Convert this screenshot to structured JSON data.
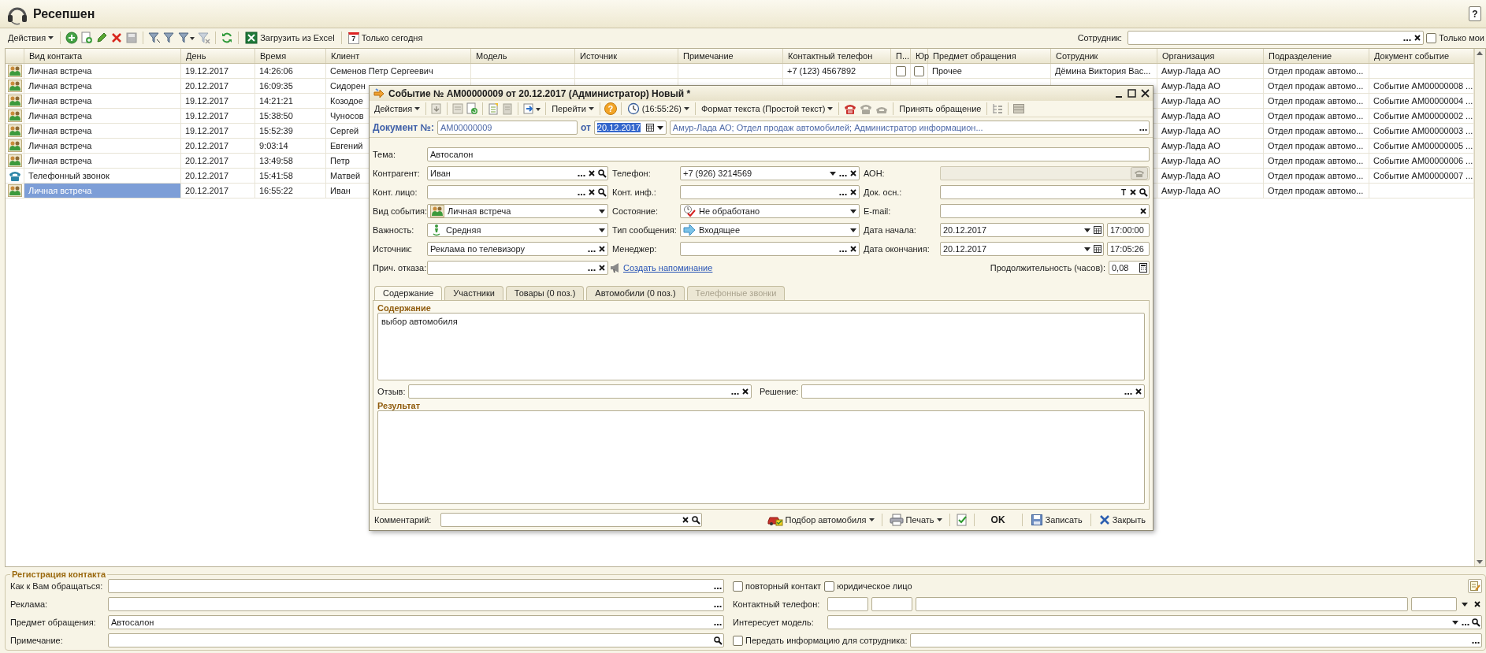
{
  "window": {
    "title": "Ресепшен",
    "help": "?"
  },
  "toolbar": {
    "items": [
      {
        "kind": "menu",
        "text": "Действия"
      },
      {
        "kind": "sep"
      },
      {
        "kind": "add"
      },
      {
        "kind": "copy"
      },
      {
        "kind": "edit"
      },
      {
        "kind": "delete"
      },
      {
        "kind": "disk"
      },
      {
        "kind": "sep"
      },
      {
        "kind": "filter"
      },
      {
        "kind": "filter-list"
      },
      {
        "kind": "filter-menu"
      },
      {
        "kind": "filter-clear"
      },
      {
        "kind": "sep"
      },
      {
        "kind": "refresh"
      },
      {
        "kind": "sep"
      },
      {
        "kind": "excel",
        "text": "Загрузить из Excel"
      },
      {
        "kind": "sep"
      },
      {
        "kind": "today",
        "text": "Только сегодня",
        "badge": "7"
      }
    ],
    "employee": {
      "label": "Сотрудник:",
      "choose": true,
      "clear": true
    },
    "only_mine": {
      "label": "Только мои",
      "checked": false
    }
  },
  "table": {
    "columns": [
      "Вид контакта",
      "День",
      "Время",
      "Клиент",
      "Модель",
      "Источник",
      "Примечание",
      "Контактный телефон",
      "П...",
      "Юр",
      "Предмет обращения",
      "Сотрудник",
      "Организация",
      "Подразделение",
      "Документ событие"
    ],
    "rows": [
      {
        "kind": "meeting",
        "selected": false,
        "cells": [
          "Личная встреча",
          "19.12.2017",
          "14:26:06",
          "Семенов Петр Сергеевич",
          null,
          null,
          null,
          "+7 (123) 4567892",
          {
            "checked": false
          },
          {
            "checked": false
          },
          "Прочее",
          "Дёмина Виктория Вас...",
          "Амур-Лада АО",
          "Отдел продаж автомо...",
          null
        ]
      },
      {
        "kind": "meeting",
        "selected": false,
        "cells": [
          "Личная встреча",
          "20.12.2017",
          "16:09:35",
          "Сидорен",
          null,
          null,
          null,
          null,
          null,
          null,
          null,
          null,
          "Амур-Лада АО",
          "Отдел продаж автомо...",
          "Событие АМ00000008 ..."
        ]
      },
      {
        "kind": "meeting",
        "selected": false,
        "cells": [
          "Личная встреча",
          "19.12.2017",
          "14:21:21",
          "Козодое",
          null,
          null,
          null,
          null,
          null,
          null,
          null,
          null,
          "Амур-Лада АО",
          "Отдел продаж автомо...",
          "Событие АМ00000004 ..."
        ]
      },
      {
        "kind": "meeting",
        "selected": false,
        "cells": [
          "Личная встреча",
          "19.12.2017",
          "15:38:50",
          "Чуносов",
          null,
          null,
          null,
          null,
          null,
          null,
          null,
          null,
          "Амур-Лада АО",
          "Отдел продаж автомо...",
          "Событие АМ00000002 ..."
        ]
      },
      {
        "kind": "meeting",
        "selected": false,
        "cells": [
          "Личная встреча",
          "19.12.2017",
          "15:52:39",
          "Сергей",
          null,
          null,
          null,
          null,
          null,
          null,
          null,
          null,
          "Амур-Лада АО",
          "Отдел продаж автомо...",
          "Событие АМ00000003 ..."
        ]
      },
      {
        "kind": "meeting",
        "selected": false,
        "cells": [
          "Личная встреча",
          "20.12.2017",
          "9:03:14",
          "Евгений",
          null,
          null,
          null,
          null,
          null,
          null,
          null,
          null,
          "Амур-Лада АО",
          "Отдел продаж автомо...",
          "Событие АМ00000005 ..."
        ]
      },
      {
        "kind": "meeting",
        "selected": false,
        "cells": [
          "Личная встреча",
          "20.12.2017",
          "13:49:58",
          "Петр",
          null,
          null,
          null,
          null,
          null,
          null,
          null,
          null,
          "Амур-Лада АО",
          "Отдел продаж автомо...",
          "Событие АМ00000006 ..."
        ]
      },
      {
        "kind": "phone",
        "selected": false,
        "cells": [
          "Телефонный звонок",
          "20.12.2017",
          "15:41:58",
          "Матвей",
          null,
          null,
          null,
          null,
          null,
          null,
          null,
          null,
          "Амур-Лада АО",
          "Отдел продаж автомо...",
          "Событие АМ00000007 ..."
        ]
      },
      {
        "kind": "meeting",
        "selected": true,
        "cells": [
          "Личная встреча",
          "20.12.2017",
          "16:55:22",
          "Иван",
          null,
          null,
          null,
          null,
          null,
          null,
          null,
          null,
          "Амур-Лада АО",
          "Отдел продаж автомо...",
          null
        ]
      }
    ]
  },
  "dialog": {
    "title": "Событие № АМ00000009 от 20.12.2017 (Администратор) Новый *",
    "toolbar": [
      {
        "kind": "menu",
        "text": "Действия"
      },
      {
        "kind": "sep"
      },
      {
        "kind": "post"
      },
      {
        "kind": "sep"
      },
      {
        "kind": "doc"
      },
      {
        "kind": "doc-copy"
      },
      {
        "kind": "sep"
      },
      {
        "kind": "doc-new"
      },
      {
        "kind": "doc-grey"
      },
      {
        "kind": "sep"
      },
      {
        "kind": "arrow-menu"
      },
      {
        "kind": "sep"
      },
      {
        "kind": "menu",
        "text": "Перейти"
      },
      {
        "kind": "sep"
      },
      {
        "kind": "help",
        "text": "?"
      },
      {
        "kind": "sep"
      },
      {
        "kind": "clock-menu",
        "text": "(16:55:26)"
      },
      {
        "kind": "sep"
      },
      {
        "kind": "menu",
        "text": "Формат текста (Простой текст)"
      },
      {
        "kind": "sep"
      },
      {
        "kind": "phone-red"
      },
      {
        "kind": "phone-grey"
      },
      {
        "kind": "phone-grey2"
      },
      {
        "kind": "sep"
      },
      {
        "kind": "text",
        "text": "Принять обращение"
      },
      {
        "kind": "sep"
      },
      {
        "kind": "tree"
      },
      {
        "kind": "sep"
      },
      {
        "kind": "list"
      }
    ],
    "document": {
      "label": "Документ №:",
      "number": "АМ00000009",
      "date_label": "от",
      "date": "20.12.2017",
      "date_selected": true,
      "info": "Амур-Лада АО; Отдел продаж автомобилей; Администратор информацион...",
      "choose": true
    },
    "subject": {
      "label": "Тема:",
      "value": "Автосалон",
      "disabled": false
    },
    "rows": [
      [
        {
          "label": "Контрагент:",
          "value": "Иван",
          "kind": "text",
          "disabled": false,
          "choose": true,
          "clear": true,
          "search": true
        },
        {
          "label": "Телефон:",
          "value": "+7 (926) 3214569",
          "kind": "text",
          "disabled": false,
          "dropdown": true,
          "choose": true,
          "clear": true
        },
        {
          "label": "АОН:",
          "kind": "text",
          "disabled": true,
          "phone": true
        }
      ],
      [
        {
          "label": "Конт. лицо:",
          "kind": "text",
          "disabled": false,
          "choose": true,
          "clear": true,
          "search": true
        },
        {
          "label": "Конт. инф.:",
          "kind": "text",
          "disabled": false,
          "choose": true,
          "clear": true
        },
        {
          "label": "Док. осн.:",
          "kind": "text",
          "disabled": false,
          "type_button": "T",
          "clear": true,
          "search": true
        }
      ],
      [
        {
          "label": "Вид события:",
          "value": "Личная встреча",
          "kind": "event",
          "disabled": false,
          "dropdown": true
        },
        {
          "label": "Состояние:",
          "value": "Не обработано",
          "kind": "state",
          "disabled": false,
          "dropdown": true
        },
        {
          "label": "E-mail:",
          "kind": "text",
          "disabled": false,
          "clear": true
        }
      ],
      [
        {
          "label": "Важность:",
          "value": "Средняя",
          "kind": "importance",
          "disabled": false,
          "dropdown": true
        },
        {
          "label": "Тип сообщения:",
          "value": "Входящее",
          "kind": "direction",
          "disabled": false,
          "dropdown": true
        },
        {
          "label": "Дата начала:",
          "value": "20.12.2017",
          "kind": "date",
          "time": "17:00:00",
          "disabled": false,
          "dropdown": true,
          "calendar": true
        }
      ],
      [
        {
          "label": "Источник:",
          "value": "Реклама по телевизору",
          "kind": "text",
          "disabled": false,
          "choose": true,
          "clear": true
        },
        {
          "label": "Менеджер:",
          "kind": "text",
          "disabled": false,
          "choose": true,
          "clear": true
        },
        {
          "label": "Дата окончания:",
          "value": "20.12.2017",
          "kind": "date",
          "time": "17:05:26",
          "disabled": false,
          "dropdown": true,
          "calendar": true
        }
      ]
    ],
    "reason": {
      "label": "Прич. отказа:",
      "disabled": false,
      "choose": true,
      "clear": true
    },
    "reminder_link": "Создать напоминание",
    "duration": {
      "label": "Продолжительность (часов):",
      "value": "0,08"
    },
    "tabs": [
      {
        "label": "Содержание",
        "selected": true,
        "disabled": false
      },
      {
        "label": "Участники",
        "selected": false,
        "disabled": false
      },
      {
        "label": "Товары (0 поз.)",
        "selected": false,
        "disabled": false
      },
      {
        "label": "Автомобили (0 поз.)",
        "selected": false,
        "disabled": false
      },
      {
        "label": "Телефонные звонки",
        "selected": false,
        "disabled": true
      }
    ],
    "content": {
      "heading": "Содержание",
      "text": "выбор автомобиля"
    },
    "feedback": [
      {
        "label": "Отзыв:",
        "choose": true,
        "clear": true
      },
      {
        "label": "Решение:",
        "choose": true,
        "clear": true
      }
    ],
    "result": {
      "heading": "Результат"
    },
    "comment": {
      "label": "Комментарий:",
      "clear": true,
      "search": true
    },
    "buttons": [
      {
        "kind": "car-menu",
        "text": "Подбор автомобиля"
      },
      {
        "kind": "print-menu",
        "text": "Печать"
      },
      {
        "kind": "check"
      },
      {
        "kind": "ok",
        "text": "OK"
      },
      {
        "kind": "save",
        "text": "Записать"
      },
      {
        "kind": "close",
        "text": "Закрыть"
      }
    ]
  },
  "registration": {
    "title": "Регистрация контакта",
    "rows": [
      {
        "field": {
          "label": "Как к Вам обращаться:",
          "choose": true
        },
        "right": {
          "kind": "checks",
          "checks": [
            {
              "label": "повторный контакт",
              "checked": false
            },
            {
              "label": "юридическое лицо",
              "checked": false
            }
          ]
        }
      },
      {
        "field": {
          "label": "Реклама:",
          "choose": true
        },
        "right": {
          "kind": "phone",
          "label": "Контактный телефон:",
          "dropdown": true,
          "clear": true
        }
      },
      {
        "field": {
          "label": "Предмет обращения:",
          "value": "Автосалон",
          "choose": true
        },
        "right": {
          "kind": "field",
          "label": "Интересует модель:",
          "dropdown": true,
          "choose": true,
          "search": true
        }
      },
      {
        "field": {
          "label": "Примечание:",
          "search": true
        },
        "right": {
          "kind": "check-field",
          "label": "Передать информацию для сотрудника:",
          "checked": false,
          "choose": true
        }
      }
    ]
  }
}
